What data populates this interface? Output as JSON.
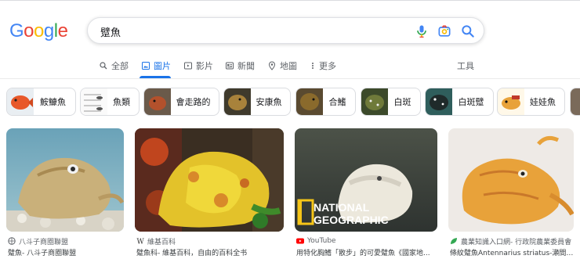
{
  "logo": {
    "letters": [
      "G",
      "o",
      "o",
      "g",
      "l",
      "e"
    ]
  },
  "search": {
    "query": "躄魚"
  },
  "tabs": [
    {
      "label": "全部"
    },
    {
      "label": "圖片"
    },
    {
      "label": "影片"
    },
    {
      "label": "新聞"
    },
    {
      "label": "地圖"
    },
    {
      "label": "更多"
    }
  ],
  "tools_label": "工具",
  "chips": [
    {
      "label": "鮟鱇魚",
      "thumb_color": "#e8582a"
    },
    {
      "label": "魚類",
      "thumb_color": "#d9d9d9"
    },
    {
      "label": "會走路的",
      "thumb_color": "#b3512c"
    },
    {
      "label": "安康魚",
      "thumb_color": "#a8823b"
    },
    {
      "label": "合鰭",
      "thumb_color": "#8a6a2c"
    },
    {
      "label": "白斑",
      "thumb_color": "#6f7a3a"
    },
    {
      "label": "白斑躄",
      "thumb_color": "#1f2a2a"
    },
    {
      "label": "娃娃魚",
      "thumb_color": "#e8a23a"
    }
  ],
  "results": [
    {
      "source": "八斗子商圈聯盟",
      "title": "躄魚- 八斗子商圈聯盟",
      "favicon": "globe-icon"
    },
    {
      "source": "維基百科",
      "title": "躄魚科- 維基百科，自由的百科全书",
      "favicon": "wikipedia-icon"
    },
    {
      "source": "YouTube",
      "title": "用特化胸鰭「散步」的可愛躄魚《國家地...",
      "favicon": "youtube-icon",
      "overlay_line1": "NATIONAL",
      "overlay_line2": "GEOGRAPHIC"
    },
    {
      "source": "農業知識入口網- 行政院農業委員會",
      "title": "條紋躄魚Antennarius striatus-瀨間帶...",
      "favicon": "leaf-icon"
    }
  ],
  "colors": {
    "accent": "#1a73e8",
    "youtube": "#ff0000"
  }
}
